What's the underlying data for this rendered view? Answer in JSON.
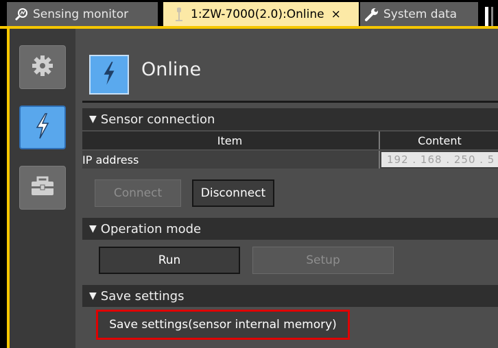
{
  "tabs": {
    "sensing_monitor": "Sensing monitor",
    "online": "1:ZW-7000(2.0):Online",
    "online_close": "×",
    "system_data": "System data"
  },
  "sidebar": {
    "items": [
      {
        "name": "settings",
        "icon": "gear-icon",
        "active": false
      },
      {
        "name": "online",
        "icon": "lightning-icon",
        "active": true
      },
      {
        "name": "tools",
        "icon": "toolbox-icon",
        "active": false
      }
    ]
  },
  "main": {
    "title": "Online",
    "sections": {
      "sensor_connection": {
        "label": "Sensor connection",
        "table": {
          "headers": [
            "Item",
            "Content"
          ],
          "rows": [
            {
              "item": "IP address",
              "content": "192 . 168 . 250 . 5"
            }
          ]
        },
        "buttons": {
          "connect": "Connect",
          "disconnect": "Disconnect"
        }
      },
      "operation_mode": {
        "label": "Operation mode",
        "buttons": {
          "run": "Run",
          "setup": "Setup"
        }
      },
      "save_settings": {
        "label": "Save settings",
        "buttons": {
          "save": "Save settings(sensor internal memory)"
        }
      }
    }
  },
  "colors": {
    "accent_yellow": "#f5c600",
    "active_blue": "#59a7ec",
    "highlight_red": "#e00000"
  }
}
